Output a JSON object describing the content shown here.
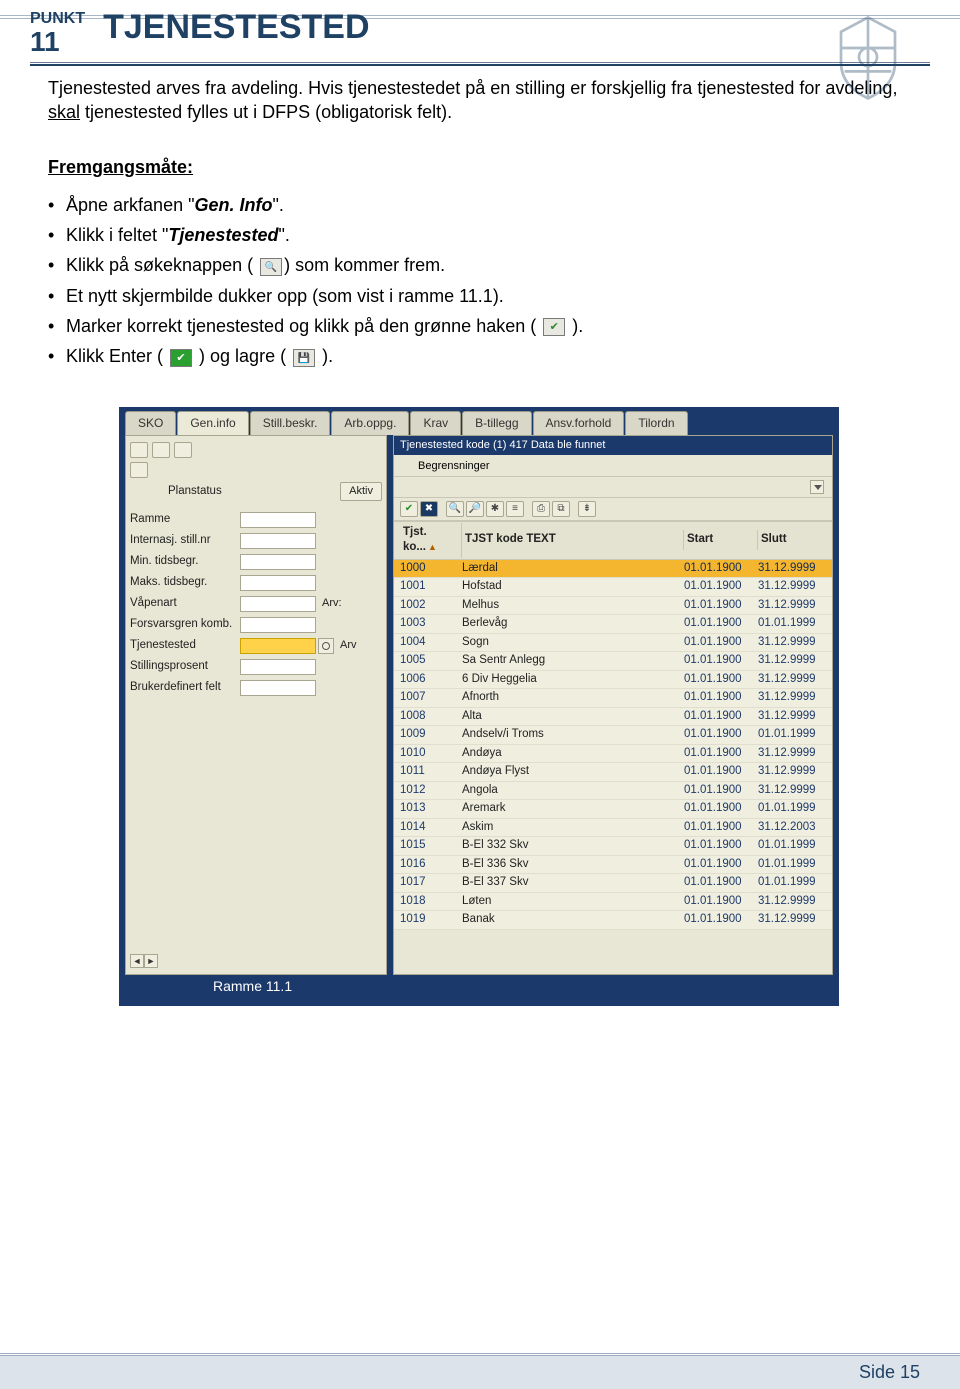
{
  "header": {
    "punkt_label": "PUNKT",
    "punkt_number": "11",
    "title": "TJENESTESTED"
  },
  "intro": {
    "line1": "Tjenestested arves fra avdeling. Hvis tjenestestedet på en stilling er forskjellig fra tjenestested for avdeling, ",
    "skal_word": "skal",
    "line2": " tjenestested fylles ut i DFPS (obligatorisk felt)."
  },
  "fremg_heading": "Fremgangsmåte:",
  "bullets": {
    "b1a": "Åpne arkfanen \"",
    "b1b": "Gen. Info",
    "b1c": "\".",
    "b2a": "Klikk i feltet \"",
    "b2b": "Tjenestested",
    "b2c": "\".",
    "b3a": "Klikk på søkeknappen ( ",
    "b3b": ") som kommer frem.",
    "b4": "Et nytt skjermbilde dukker opp (som vist i ramme 11.1).",
    "b5a": "Marker korrekt tjenestested og klikk på den grønne haken ( ",
    "b5b": " ).",
    "b6a": "Klikk Enter ( ",
    "b6b": " ) og lagre ( ",
    "b6c": " )."
  },
  "sap": {
    "tabs": [
      "SKO",
      "Gen.info",
      "Still.beskr.",
      "Arb.oppg.",
      "Krav",
      "B-tillegg",
      "Ansv.forhold",
      "Tilordn"
    ],
    "active_tab_index": 1,
    "planstatus_label": "Planstatus",
    "planstatus_btn": "Aktiv",
    "left_fields": [
      {
        "label": "Ramme",
        "hl": false
      },
      {
        "label": "Internasj. still.nr",
        "hl": false
      },
      {
        "label": "Min. tidsbegr.",
        "hl": false
      },
      {
        "label": "Maks. tidsbegr.",
        "hl": false
      },
      {
        "label": "Våpenart",
        "hl": false,
        "extra": "Arv:"
      },
      {
        "label": "Forsvarsgren komb.",
        "hl": false
      },
      {
        "label": "Tjenestested",
        "hl": true,
        "search": true,
        "extra": "Arv"
      },
      {
        "label": "Stillingsprosent",
        "hl": false
      },
      {
        "label": "Brukerdefinert felt",
        "hl": false
      }
    ],
    "popup_title": "Tjenestested kode (1)  417 Data ble funnet",
    "popup_sub": "Begrensninger",
    "popup_headers": [
      "Tjst. ko...",
      "TJST kode TEXT",
      "",
      "Start",
      "Slutt"
    ],
    "rows": [
      {
        "code": "1000",
        "text": "Lærdal",
        "start": "01.01.1900",
        "end": "31.12.9999",
        "sel": true
      },
      {
        "code": "1001",
        "text": "Hofstad",
        "start": "01.01.1900",
        "end": "31.12.9999"
      },
      {
        "code": "1002",
        "text": "Melhus",
        "start": "01.01.1900",
        "end": "31.12.9999"
      },
      {
        "code": "1003",
        "text": "Berlevåg",
        "start": "01.01.1900",
        "end": "01.01.1999"
      },
      {
        "code": "1004",
        "text": "Sogn",
        "start": "01.01.1900",
        "end": "31.12.9999"
      },
      {
        "code": "1005",
        "text": "Sa Sentr Anlegg",
        "start": "01.01.1900",
        "end": "31.12.9999"
      },
      {
        "code": "1006",
        "text": "6 Div Heggelia",
        "start": "01.01.1900",
        "end": "31.12.9999"
      },
      {
        "code": "1007",
        "text": "Afnorth",
        "start": "01.01.1900",
        "end": "31.12.9999"
      },
      {
        "code": "1008",
        "text": "Alta",
        "start": "01.01.1900",
        "end": "31.12.9999"
      },
      {
        "code": "1009",
        "text": "Andselv/i Troms",
        "start": "01.01.1900",
        "end": "01.01.1999"
      },
      {
        "code": "1010",
        "text": "Andøya",
        "start": "01.01.1900",
        "end": "31.12.9999"
      },
      {
        "code": "1011",
        "text": "Andøya Flyst",
        "start": "01.01.1900",
        "end": "31.12.9999"
      },
      {
        "code": "1012",
        "text": "Angola",
        "start": "01.01.1900",
        "end": "31.12.9999"
      },
      {
        "code": "1013",
        "text": "Aremark",
        "start": "01.01.1900",
        "end": "01.01.1999"
      },
      {
        "code": "1014",
        "text": "Askim",
        "start": "01.01.1900",
        "end": "31.12.2003"
      },
      {
        "code": "1015",
        "text": "B-El 332 Skv",
        "start": "01.01.1900",
        "end": "01.01.1999"
      },
      {
        "code": "1016",
        "text": "B-El 336 Skv",
        "start": "01.01.1900",
        "end": "01.01.1999"
      },
      {
        "code": "1017",
        "text": "B-El 337 Skv",
        "start": "01.01.1900",
        "end": "01.01.1999"
      },
      {
        "code": "1018",
        "text": "Løten",
        "start": "01.01.1900",
        "end": "31.12.9999"
      },
      {
        "code": "1019",
        "text": "Banak",
        "start": "01.01.1900",
        "end": "31.12.9999"
      }
    ]
  },
  "ramme_label": "Ramme 11.1",
  "footer": "Side 15",
  "icon_labels": {
    "check": "✔",
    "close": "✖",
    "search1": "🔍",
    "search2": "🔎",
    "star": "✱",
    "list": "≡",
    "print": "⎙",
    "copyrow": "⧉",
    "pin": "⇟"
  },
  "scroll_labels": {
    "left": "◄",
    "right": "►"
  },
  "chart_data": {
    "type": "table",
    "title": "Tjenestested kode (1)  417 Data ble funnet",
    "columns": [
      "Tjst. kode",
      "TJST kode TEXT",
      "Start",
      "Slutt"
    ],
    "rows": [
      [
        "1000",
        "Lærdal",
        "01.01.1900",
        "31.12.9999"
      ],
      [
        "1001",
        "Hofstad",
        "01.01.1900",
        "31.12.9999"
      ],
      [
        "1002",
        "Melhus",
        "01.01.1900",
        "31.12.9999"
      ],
      [
        "1003",
        "Berlevåg",
        "01.01.1900",
        "01.01.1999"
      ],
      [
        "1004",
        "Sogn",
        "01.01.1900",
        "31.12.9999"
      ],
      [
        "1005",
        "Sa Sentr Anlegg",
        "01.01.1900",
        "31.12.9999"
      ],
      [
        "1006",
        "6 Div Heggelia",
        "01.01.1900",
        "31.12.9999"
      ],
      [
        "1007",
        "Afnorth",
        "01.01.1900",
        "31.12.9999"
      ],
      [
        "1008",
        "Alta",
        "01.01.1900",
        "31.12.9999"
      ],
      [
        "1009",
        "Andselv/i Troms",
        "01.01.1900",
        "01.01.1999"
      ],
      [
        "1010",
        "Andøya",
        "01.01.1900",
        "31.12.9999"
      ],
      [
        "1011",
        "Andøya Flyst",
        "01.01.1900",
        "31.12.9999"
      ],
      [
        "1012",
        "Angola",
        "01.01.1900",
        "31.12.9999"
      ],
      [
        "1013",
        "Aremark",
        "01.01.1900",
        "01.01.1999"
      ],
      [
        "1014",
        "Askim",
        "01.01.1900",
        "31.12.2003"
      ],
      [
        "1015",
        "B-El 332 Skv",
        "01.01.1900",
        "01.01.1999"
      ],
      [
        "1016",
        "B-El 336 Skv",
        "01.01.1900",
        "01.01.1999"
      ],
      [
        "1017",
        "B-El 337 Skv",
        "01.01.1900",
        "01.01.1999"
      ],
      [
        "1018",
        "Løten",
        "01.01.1900",
        "31.12.9999"
      ],
      [
        "1019",
        "Banak",
        "01.01.1900",
        "31.12.9999"
      ]
    ]
  }
}
